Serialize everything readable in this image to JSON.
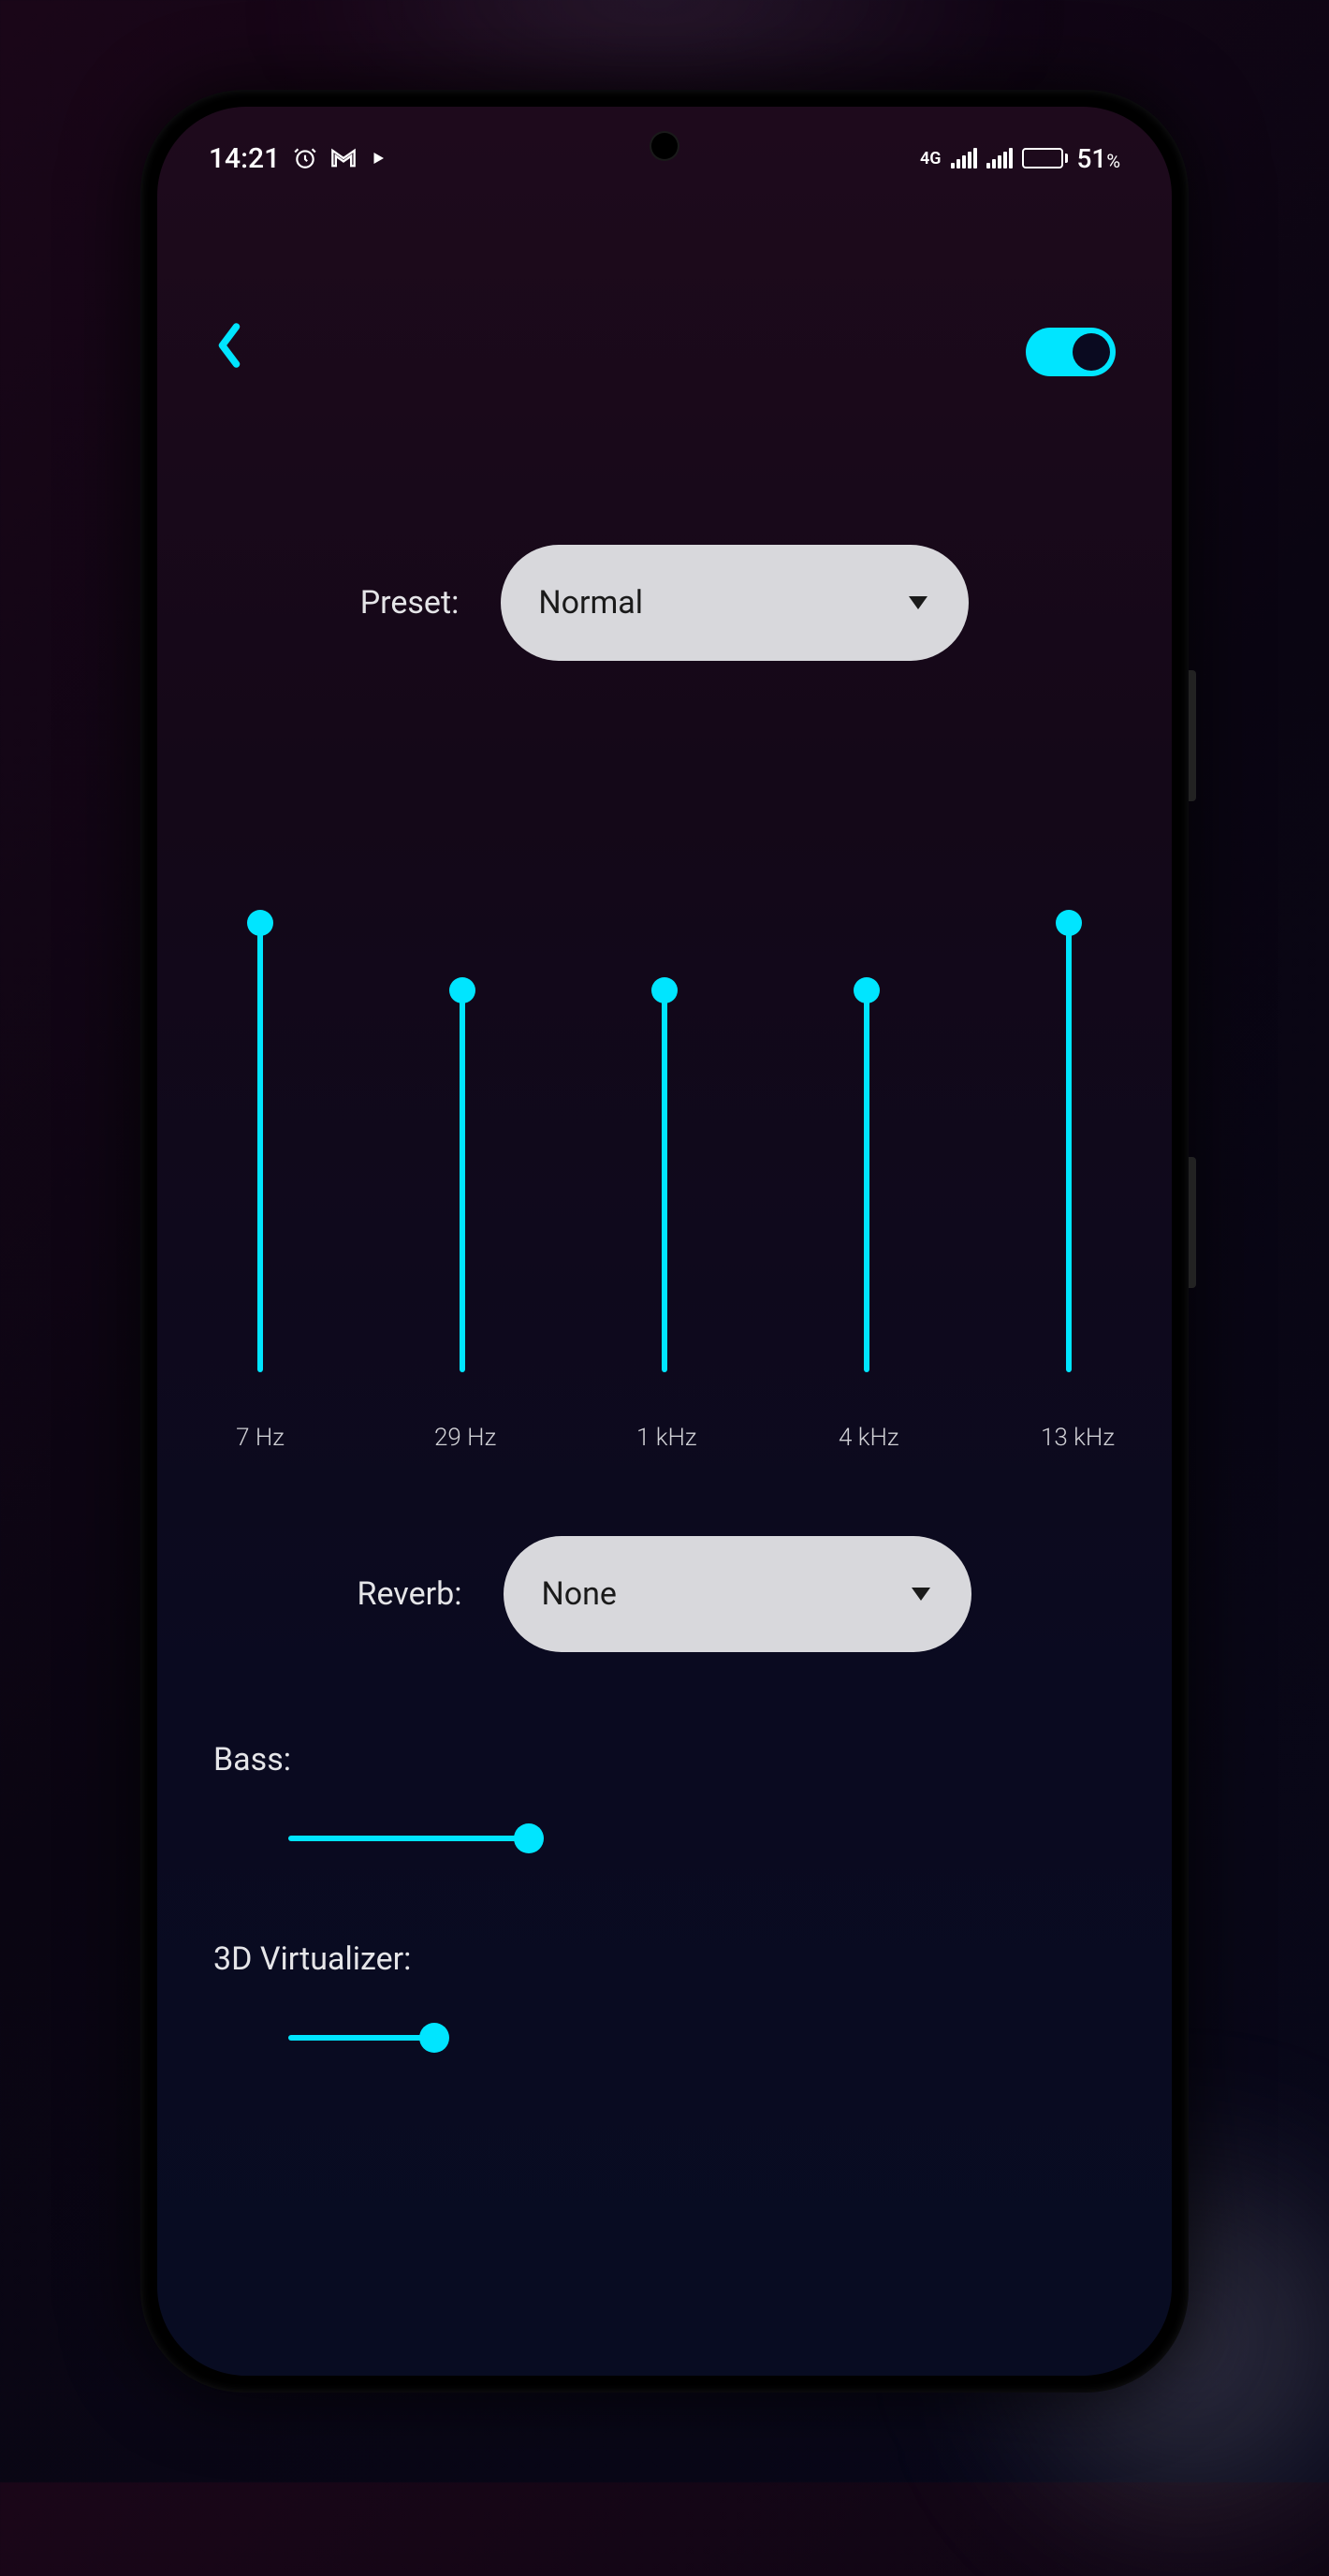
{
  "statusBar": {
    "time": "14:21",
    "network": "4G",
    "batteryPct": "51",
    "batteryPctSymbol": "%"
  },
  "header": {
    "toggleOn": true
  },
  "preset": {
    "label": "Preset:",
    "value": "Normal"
  },
  "equalizer": {
    "bands": [
      {
        "label": "7 Hz",
        "value": 100
      },
      {
        "label": "29 Hz",
        "value": 85
      },
      {
        "label": "1 kHz",
        "value": 85
      },
      {
        "label": "4 kHz",
        "value": 85
      },
      {
        "label": "13 kHz",
        "value": 100
      }
    ]
  },
  "reverb": {
    "label": "Reverb:",
    "value": "None"
  },
  "bass": {
    "label": "Bass:",
    "value": 33
  },
  "virtualizer": {
    "label": "3D Virtualizer:",
    "value": 20
  },
  "colors": {
    "accent": "#00e5ff"
  }
}
